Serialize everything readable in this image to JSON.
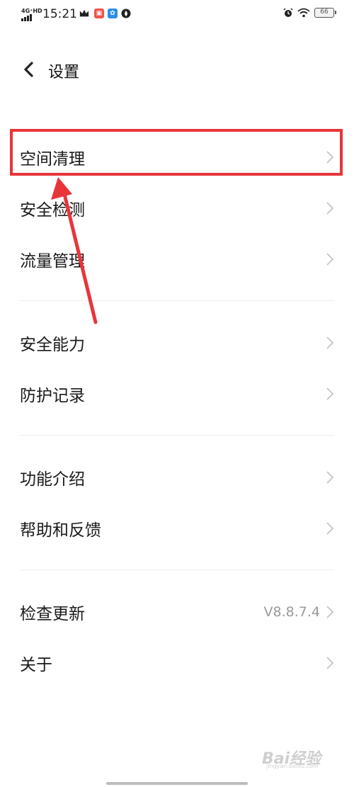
{
  "status_bar": {
    "network": "4G⁺HD",
    "time": "15:21",
    "battery": "66",
    "icons": [
      "crown-icon",
      "app-red-icon",
      "app-blue-icon",
      "flame-icon",
      "alarm-icon",
      "wifi-icon",
      "battery-icon"
    ]
  },
  "header": {
    "back_icon": "chevron-left-icon",
    "title": "设置"
  },
  "menu": {
    "groups": [
      {
        "items": [
          {
            "label": "空间清理"
          },
          {
            "label": "安全检测"
          },
          {
            "label": "流量管理"
          }
        ]
      },
      {
        "items": [
          {
            "label": "安全能力"
          },
          {
            "label": "防护记录"
          }
        ]
      },
      {
        "items": [
          {
            "label": "功能介绍"
          },
          {
            "label": "帮助和反馈"
          }
        ]
      },
      {
        "items": [
          {
            "label": "检查更新",
            "value": "V8.8.7.4"
          },
          {
            "label": "关于"
          }
        ]
      }
    ]
  },
  "annotation": {
    "highlight_color": "#e8353a",
    "highlighted_item": "空间清理"
  },
  "watermark": {
    "text": "Bai经验",
    "sub": "jingyan.baidu.com"
  },
  "colors": {
    "background": "#ffffff",
    "text": "#1a1a1a",
    "secondary_text": "#9a9a9a",
    "chevron": "#c4c4c4",
    "divider": "#eeeeee"
  }
}
